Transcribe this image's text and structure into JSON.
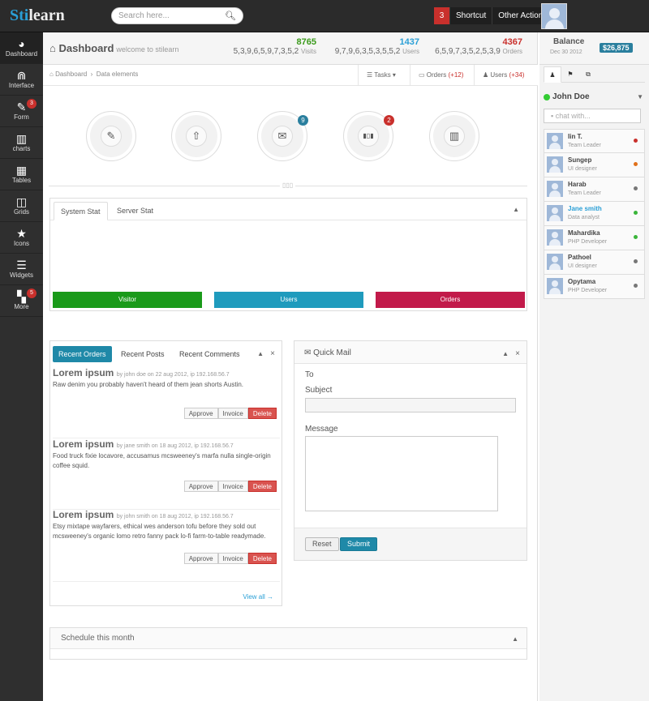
{
  "brand": {
    "part1": "Sti",
    "part2": "learn"
  },
  "search": {
    "placeholder": "Search here..."
  },
  "topbar": {
    "count": "3",
    "shortcut": "Shortcut",
    "other": "Other Action"
  },
  "nav": [
    {
      "label": "Dashboard",
      "icon": "dashboard-icon",
      "glyph": "◕",
      "badge": ""
    },
    {
      "label": "Interface",
      "icon": "magnet-icon",
      "glyph": "⋒",
      "badge": ""
    },
    {
      "label": "Form",
      "icon": "edit-icon",
      "glyph": "✎",
      "badge": "3"
    },
    {
      "label": "charts",
      "icon": "bar-chart-icon",
      "glyph": "▥",
      "badge": ""
    },
    {
      "label": "Tables",
      "icon": "table-icon",
      "glyph": "▦",
      "badge": ""
    },
    {
      "label": "Grids",
      "icon": "columns-icon",
      "glyph": "◫",
      "badge": ""
    },
    {
      "label": "Icons",
      "icon": "star-icon",
      "glyph": "★",
      "badge": ""
    },
    {
      "label": "Widgets",
      "icon": "list-icon",
      "glyph": "☰",
      "badge": ""
    },
    {
      "label": "More",
      "icon": "grid-icon",
      "glyph": "▚",
      "badge": "5"
    }
  ],
  "header": {
    "title": "Dashboard",
    "subtitle": "welcome to stilearn"
  },
  "stats": [
    {
      "spark": "5,3,9,6,5,9,7,3,5,2",
      "value": "8765",
      "label": "Visits",
      "color": "#3a9a1a"
    },
    {
      "spark": "9,7,9,6,3,5,3,5,5,2",
      "value": "1437",
      "label": "Users",
      "color": "#2a9fd6"
    },
    {
      "spark": "6,5,9,7,3,5,2,5,3,9",
      "value": "4367",
      "label": "Orders",
      "color": "#c9302c"
    }
  ],
  "breadcrumb": {
    "home": "Dashboard",
    "current": "Data elements"
  },
  "crumbtabs": {
    "tasks": "Tasks",
    "orders": "Orders",
    "orders_count": "(+12)",
    "users": "Users",
    "users_count": "(+34)"
  },
  "quick": [
    {
      "glyph": "✎",
      "icon": "edit-icon",
      "badge": "",
      "badge_color": ""
    },
    {
      "glyph": "⇧",
      "icon": "upload-icon",
      "badge": "",
      "badge_color": ""
    },
    {
      "glyph": "✉",
      "icon": "mail-icon",
      "badge": "9",
      "badge_color": "#2a7f9e"
    },
    {
      "glyph": "▮▯▮",
      "icon": "barcode-icon",
      "badge": "2",
      "badge_color": "#c9302c"
    },
    {
      "glyph": "▥",
      "icon": "chart-icon",
      "badge": "",
      "badge_color": ""
    }
  ],
  "divider_glyph": "▯▯▯",
  "stat_tabs": {
    "system": "System Stat",
    "server": "Server Stat"
  },
  "stat_bars": [
    {
      "label": "Visitor",
      "color": "#1a9a1a"
    },
    {
      "label": "Users",
      "color": "#1f9bbd"
    },
    {
      "label": "Orders",
      "color": "#c21a4a"
    }
  ],
  "recent_tabs": {
    "orders": "Recent Orders",
    "posts": "Recent Posts",
    "comments": "Recent Comments"
  },
  "posts": [
    {
      "title": "Lorem ipsum",
      "meta": "by john doe on 22 aug 2012, ip 192.168.56.7",
      "body": "Raw denim you probably haven't heard of them jean shorts Austin."
    },
    {
      "title": "Lorem ipsum",
      "meta": "by jane smith on 18 aug 2012, ip 192.168.56.7",
      "body": "Food truck fixie locavore, accusamus mcsweeney's marfa nulla single-origin coffee squid."
    },
    {
      "title": "Lorem ipsum",
      "meta": "by john smith on 18 aug 2012, ip 192.168.56.7",
      "body": "Etsy mixtape wayfarers, ethical wes anderson tofu before they sold out mcsweeney's organic lomo retro fanny pack lo-fi farm-to-table readymade."
    }
  ],
  "post_actions": {
    "approve": "Approve",
    "invoice": "Invoice",
    "delete": "Delete"
  },
  "view_all": "View all →",
  "quickmail": {
    "title": "Quick Mail",
    "to": "To",
    "subject": "Subject",
    "message": "Message",
    "reset": "Reset",
    "submit": "Submit"
  },
  "schedule": {
    "title": "Schedule this month"
  },
  "balance": {
    "label": "Balance",
    "date": "Dec 30 2012",
    "amount": "$26,875"
  },
  "chat": {
    "user": "John Doe",
    "placeholder": "chat with...",
    "contacts": [
      {
        "name": "Iin T.",
        "role": "Team Leader",
        "status": "#c9302c",
        "highlight": false
      },
      {
        "name": "Sungep",
        "role": "UI designer",
        "status": "#e0701a",
        "highlight": false
      },
      {
        "name": "Harab",
        "role": "Team Leader",
        "status": "#777777",
        "highlight": false
      },
      {
        "name": "Jane smith",
        "role": "Data analyst",
        "status": "#3ab53a",
        "highlight": true
      },
      {
        "name": "Mahardika",
        "role": "PHP Developer",
        "status": "#3ab53a",
        "highlight": false
      },
      {
        "name": "Pathoel",
        "role": "UI designer",
        "status": "#777777",
        "highlight": false
      },
      {
        "name": "Opytama",
        "role": "PHP Developer",
        "status": "#777777",
        "highlight": false
      }
    ]
  }
}
